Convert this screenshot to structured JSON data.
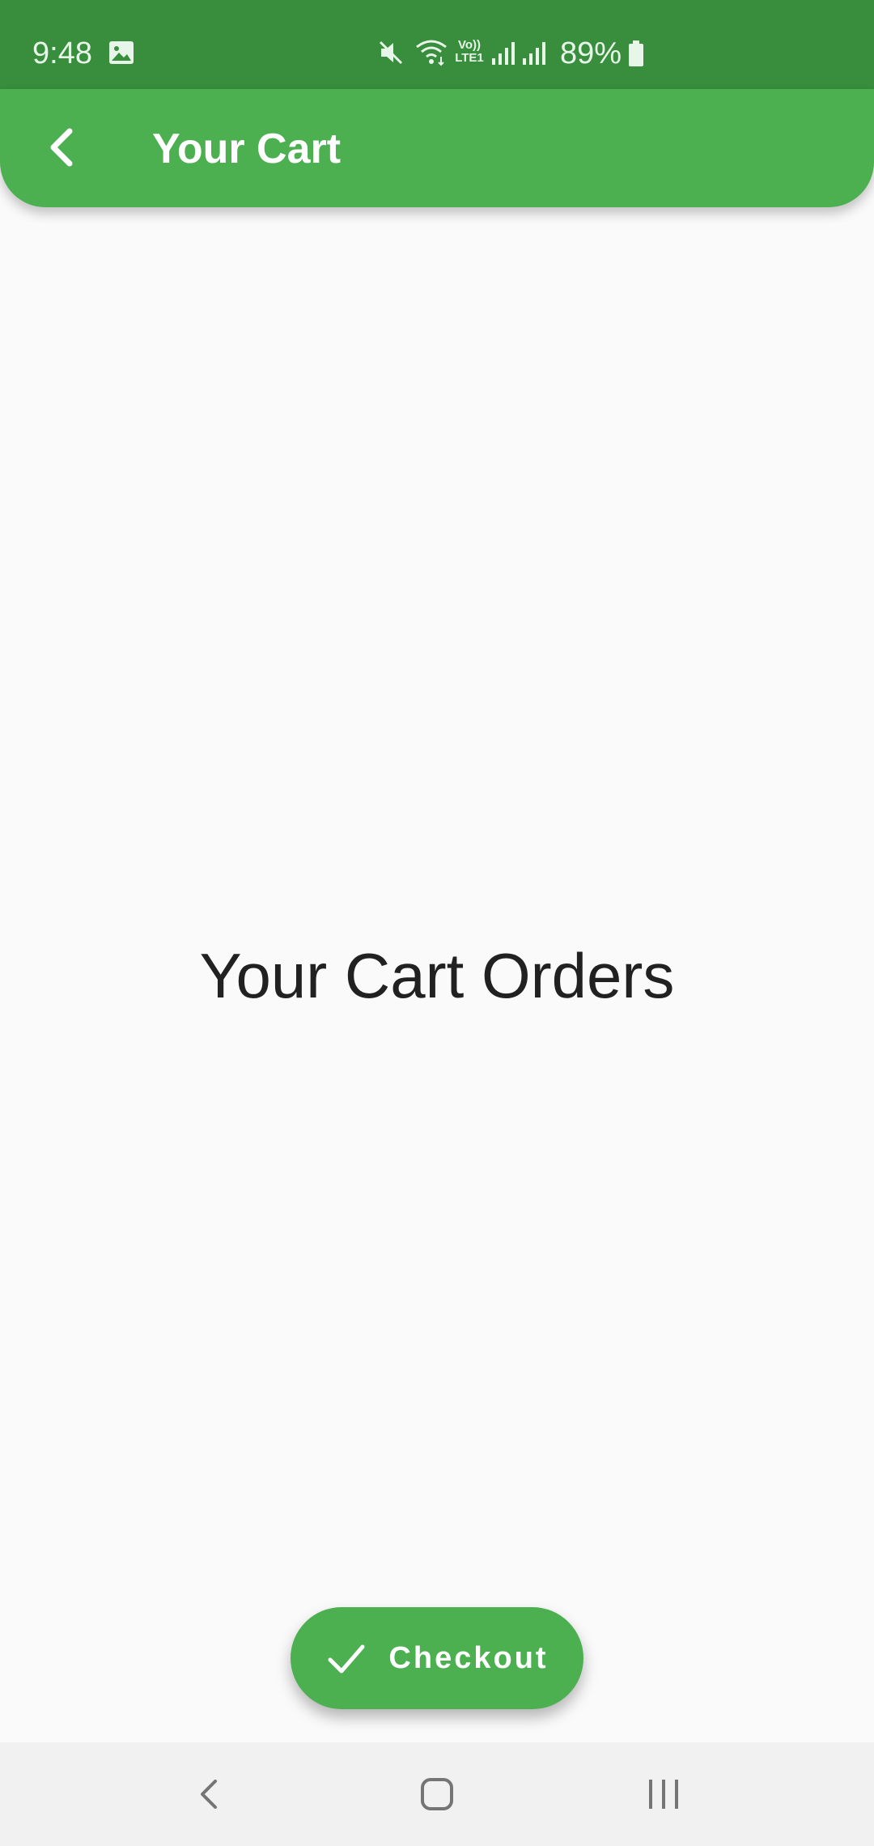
{
  "status_bar": {
    "time": "9:48",
    "volte_line1": "Vo))",
    "volte_line2": "LTE1",
    "battery": "89%"
  },
  "app_bar": {
    "title": "Your Cart",
    "color": "#4caf50"
  },
  "main": {
    "text": "Your Cart Orders"
  },
  "fab": {
    "label": "Checkout",
    "icon": "check-icon"
  },
  "nav_bar": {
    "icons": [
      "back-icon",
      "home-icon",
      "recents-icon"
    ]
  },
  "colors": {
    "status_bar": "#388e3c",
    "accent": "#4caf50",
    "background": "#fafafa"
  }
}
